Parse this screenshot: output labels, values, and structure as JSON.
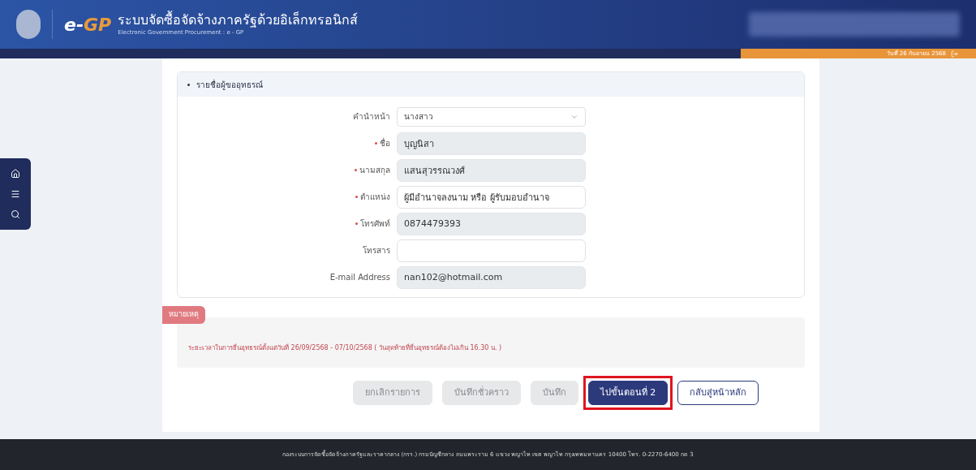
{
  "header": {
    "logo_text": "e-",
    "logo_accent": "GP",
    "title": "ระบบจัดซื้อจัดจ้างภาครัฐด้วยอิเล็กทรอนิกส์",
    "subtitle": "Electronic Government Procurement : e - GP",
    "date": "วันที่ 26 กันยายน 2568"
  },
  "section": {
    "title": "รายชื่อผู้ขออุทธรณ์"
  },
  "fields": [
    {
      "label": "คำนำหน้า",
      "required": false,
      "kind": "select",
      "value": "นางสาว",
      "disabled": false
    },
    {
      "label": "ชื่อ",
      "required": true,
      "kind": "text",
      "value": "บุญนิสา",
      "disabled": true
    },
    {
      "label": "นามสกุล",
      "required": true,
      "kind": "text",
      "value": "แสนสุวรรณวงศ์",
      "disabled": true
    },
    {
      "label": "ตำแหน่ง",
      "required": true,
      "kind": "text",
      "value": "ผู้มีอำนาจลงนาม หรือ ผู้รับมอบอำนาจ",
      "disabled": false
    },
    {
      "label": "โทรศัพท์",
      "required": true,
      "kind": "text",
      "value": "0874479393",
      "disabled": true
    },
    {
      "label": "โทรสาร",
      "required": false,
      "kind": "text",
      "disabled": false
    },
    {
      "label": "E-mail Address",
      "required": false,
      "kind": "text",
      "value": "nan102@hotmail.com",
      "disabled": true
    }
  ],
  "note": {
    "tag": "หมายเหตุ",
    "text": "ระยะเวลาในการยื่นอุทธรณ์ตั้งแต่วันที่ 26/09/2568 - 07/10/2568 ( วันสุดท้ายที่ยื่นอุทธรณ์ต้องไม่เกิน 16.30 น. )"
  },
  "buttons": [
    {
      "label": "ยกเลิกรายการ",
      "kind": "secondary",
      "disabled": true,
      "highlighted": false
    },
    {
      "label": "บันทึกชั่วคราว",
      "kind": "secondary",
      "disabled": true,
      "highlighted": false
    },
    {
      "label": "บันทึก",
      "kind": "secondary",
      "disabled": true,
      "highlighted": false
    },
    {
      "label": "ไปขั้นตอนที่ 2",
      "kind": "primary",
      "disabled": false,
      "highlighted": true
    },
    {
      "label": "กลับสู่หน้าหลัก",
      "kind": "outline",
      "disabled": false,
      "highlighted": false
    }
  ],
  "footer": {
    "text": "กองระบบการจัดซื้อจัดจ้างภาครัฐและราคากลาง (กรร.) กรมบัญชีกลาง ถนนพระราม 6 แขวง พญาไท เขต พญาไท กรุงเทพมหานคร 10400 โทร. 0-2270-6400 กด 3"
  }
}
